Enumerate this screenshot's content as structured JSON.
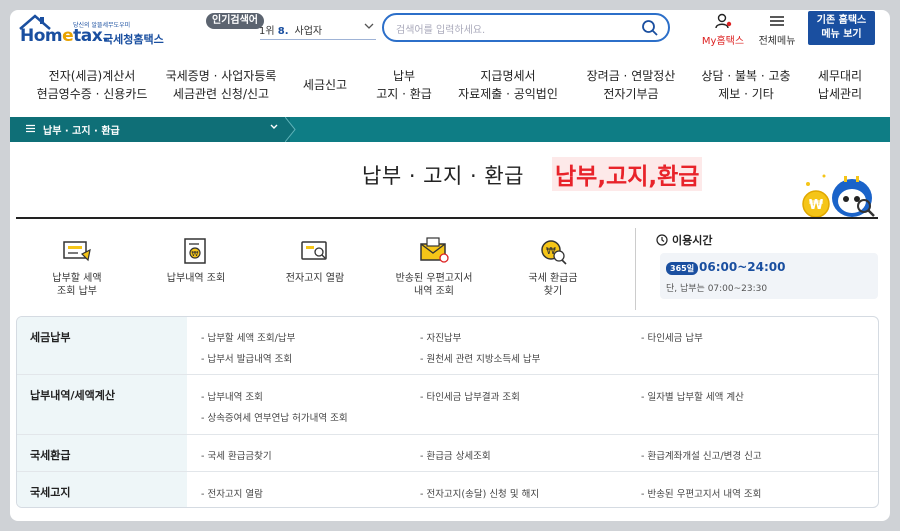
{
  "header": {
    "logo_small": "당신의 알뜰세무도우미",
    "logo_main_a": "Hom",
    "logo_main_e": "e",
    "logo_main_b": "tax.",
    "logo_sub": "국세청홈택스",
    "popular_label": "인기검색어",
    "rank_prefix": "1위",
    "rank_num": "8.",
    "rank_text": "사업자",
    "search_placeholder": "검색어를 입력하세요.",
    "my_hometax": "My홈택스",
    "all_menu": "전체메뉴",
    "old_btn_line1": "기존 홈택스",
    "old_btn_line2": "메뉴 보기"
  },
  "nav": [
    {
      "line1": "전자(세금)계산서",
      "line2": "현금영수증 · 신용카드"
    },
    {
      "line1": "국세증명 · 사업자등록",
      "line2": "세금관련 신청/신고"
    },
    {
      "line1": "세금신고",
      "line2": ""
    },
    {
      "line1": "납부",
      "line2": "고지 · 환급"
    },
    {
      "line1": "지급명세서",
      "line2": "자료제출 · 공익법인"
    },
    {
      "line1": "장려금 · 연말정산",
      "line2": "전자기부금"
    },
    {
      "line1": "상담 · 불복 · 고충",
      "line2": "제보 · 기타"
    },
    {
      "line1": "세무대리",
      "line2": "납세관리"
    }
  ],
  "breadcrumb": {
    "label": "납부 · 고지 · 환급"
  },
  "title": {
    "main": "납부 · 고지 · 환급",
    "highlight": "납부,고지,환급"
  },
  "quick_menu": [
    {
      "icon": "tax-bill-icon",
      "line1": "납부할 세액",
      "line2": "조회 납부"
    },
    {
      "icon": "payment-history-icon",
      "line1": "납부내역 조회",
      "line2": ""
    },
    {
      "icon": "e-notice-icon",
      "line1": "전자고지 열람",
      "line2": ""
    },
    {
      "icon": "returned-mail-icon",
      "line1": "반송된 우편고지서",
      "line2": "내역 조회"
    },
    {
      "icon": "refund-search-icon",
      "line1": "국세 환급금",
      "line2": "찾기"
    }
  ],
  "hours": {
    "title": "이용시간",
    "badge": "365일",
    "main": "06:00~24:00",
    "sub": "단, 납부는 07:00~23:30"
  },
  "table": [
    {
      "head": "세금납부",
      "links": [
        "납부할 세액 조회/납부",
        "자진납부",
        "타인세금 납부",
        "납부서 발급내역 조회",
        "원천세 관련 지방소득세 납부"
      ]
    },
    {
      "head": "납부내역/세액계산",
      "links": [
        "납부내역 조회",
        "타인세금 납부결과 조회",
        "일자별 납부할 세액 계산",
        "상속증여세 연부연납 허가내역 조회"
      ]
    },
    {
      "head": "국세환급",
      "links": [
        "국세 환급금찾기",
        "환급금 상세조회",
        "환급계좌개설 신고/변경 신고"
      ]
    },
    {
      "head": "국세고지",
      "links": [
        "전자고지 열람",
        "전자고지(송달) 신청 및 해지",
        "반송된 우편고지서 내역 조회"
      ]
    }
  ],
  "colors": {
    "brand_blue": "#1a4fa0",
    "teal": "#0e7d85",
    "red": "#e8232a"
  }
}
